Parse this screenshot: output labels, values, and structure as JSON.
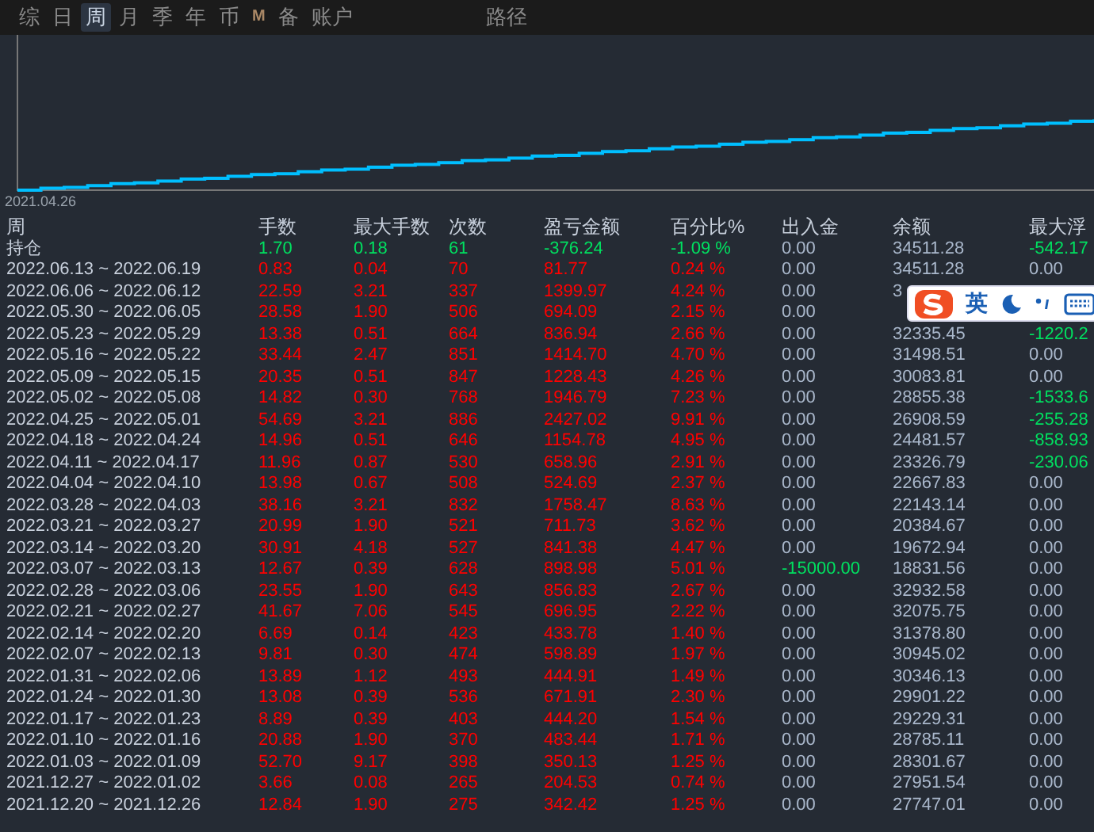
{
  "tabs": [
    {
      "label": "综",
      "selected": false
    },
    {
      "label": "日",
      "selected": false
    },
    {
      "label": "周",
      "selected": true
    },
    {
      "label": "月",
      "selected": false
    },
    {
      "label": "季",
      "selected": false
    },
    {
      "label": "年",
      "selected": false
    },
    {
      "label": "币",
      "selected": false
    },
    {
      "label": "M",
      "selected": false
    },
    {
      "label": "备",
      "selected": false
    },
    {
      "label": "账户",
      "selected": false
    }
  ],
  "path_tab": {
    "label": "路径",
    "selected": false
  },
  "chart": {
    "start_label": "2021.04.26"
  },
  "table": {
    "columns": [
      "周",
      "手数",
      "最大手数",
      "次数",
      "盈亏金额",
      "百分比%",
      "出入金",
      "余额",
      "最大浮"
    ],
    "rows": [
      {
        "kind": "holding",
        "cells": [
          "持仓",
          "1.70",
          "0.18",
          "61",
          "-376.24",
          "-1.09 %",
          "0.00",
          "34511.28",
          "-542.17"
        ],
        "cash_negative": false,
        "float_negative": true
      },
      {
        "kind": "week",
        "cells": [
          "2022.06.13 ~ 2022.06.19",
          "0.83",
          "0.04",
          "70",
          "81.77",
          "0.24 %",
          "0.00",
          "34511.28",
          "0.00"
        ],
        "cash_negative": false,
        "float_negative": false
      },
      {
        "kind": "week",
        "cells": [
          "2022.06.06 ~ 2022.06.12",
          "22.59",
          "3.21",
          "337",
          "1399.97",
          "4.24 %",
          "0.00",
          "3"
        ],
        "cash_negative": false
      },
      {
        "kind": "week",
        "cells": [
          "2022.05.30 ~ 2022.06.05",
          "28.58",
          "1.90",
          "506",
          "694.09",
          "2.15 %",
          "0.00"
        ],
        "cash_negative": false
      },
      {
        "kind": "week",
        "cells": [
          "2022.05.23 ~ 2022.05.29",
          "13.38",
          "0.51",
          "664",
          "836.94",
          "2.66 %",
          "0.00",
          "32335.45",
          "-1220.2"
        ],
        "cash_negative": false,
        "float_negative": true
      },
      {
        "kind": "week",
        "cells": [
          "2022.05.16 ~ 2022.05.22",
          "33.44",
          "2.47",
          "851",
          "1414.70",
          "4.70 %",
          "0.00",
          "31498.51",
          "0.00"
        ],
        "cash_negative": false,
        "float_negative": false
      },
      {
        "kind": "week",
        "cells": [
          "2022.05.09 ~ 2022.05.15",
          "20.35",
          "0.51",
          "847",
          "1228.43",
          "4.26 %",
          "0.00",
          "30083.81",
          "0.00"
        ],
        "cash_negative": false,
        "float_negative": false
      },
      {
        "kind": "week",
        "cells": [
          "2022.05.02 ~ 2022.05.08",
          "14.82",
          "0.30",
          "768",
          "1946.79",
          "7.23 %",
          "0.00",
          "28855.38",
          "-1533.6"
        ],
        "cash_negative": false,
        "float_negative": true
      },
      {
        "kind": "week",
        "cells": [
          "2022.04.25 ~ 2022.05.01",
          "54.69",
          "3.21",
          "886",
          "2427.02",
          "9.91 %",
          "0.00",
          "26908.59",
          "-255.28"
        ],
        "cash_negative": false,
        "float_negative": true
      },
      {
        "kind": "week",
        "cells": [
          "2022.04.18 ~ 2022.04.24",
          "14.96",
          "0.51",
          "646",
          "1154.78",
          "4.95 %",
          "0.00",
          "24481.57",
          "-858.93"
        ],
        "cash_negative": false,
        "float_negative": true
      },
      {
        "kind": "week",
        "cells": [
          "2022.04.11 ~ 2022.04.17",
          "11.96",
          "0.87",
          "530",
          "658.96",
          "2.91 %",
          "0.00",
          "23326.79",
          "-230.06"
        ],
        "cash_negative": false,
        "float_negative": true
      },
      {
        "kind": "week",
        "cells": [
          "2022.04.04 ~ 2022.04.10",
          "13.98",
          "0.67",
          "508",
          "524.69",
          "2.37 %",
          "0.00",
          "22667.83",
          "0.00"
        ],
        "cash_negative": false,
        "float_negative": false
      },
      {
        "kind": "week",
        "cells": [
          "2022.03.28 ~ 2022.04.03",
          "38.16",
          "3.21",
          "832",
          "1758.47",
          "8.63 %",
          "0.00",
          "22143.14",
          "0.00"
        ],
        "cash_negative": false,
        "float_negative": false
      },
      {
        "kind": "week",
        "cells": [
          "2022.03.21 ~ 2022.03.27",
          "20.99",
          "1.90",
          "521",
          "711.73",
          "3.62 %",
          "0.00",
          "20384.67",
          "0.00"
        ],
        "cash_negative": false,
        "float_negative": false
      },
      {
        "kind": "week",
        "cells": [
          "2022.03.14 ~ 2022.03.20",
          "30.91",
          "4.18",
          "527",
          "841.38",
          "4.47 %",
          "0.00",
          "19672.94",
          "0.00"
        ],
        "cash_negative": false,
        "float_negative": false
      },
      {
        "kind": "week",
        "cells": [
          "2022.03.07 ~ 2022.03.13",
          "12.67",
          "0.39",
          "628",
          "898.98",
          "5.01 %",
          "-15000.00",
          "18831.56",
          "0.00"
        ],
        "cash_negative": true,
        "float_negative": false
      },
      {
        "kind": "week",
        "cells": [
          "2022.02.28 ~ 2022.03.06",
          "23.55",
          "1.90",
          "643",
          "856.83",
          "2.67 %",
          "0.00",
          "32932.58",
          "0.00"
        ],
        "cash_negative": false,
        "float_negative": false
      },
      {
        "kind": "week",
        "cells": [
          "2022.02.21 ~ 2022.02.27",
          "41.67",
          "7.06",
          "545",
          "696.95",
          "2.22 %",
          "0.00",
          "32075.75",
          "0.00"
        ],
        "cash_negative": false,
        "float_negative": false
      },
      {
        "kind": "week",
        "cells": [
          "2022.02.14 ~ 2022.02.20",
          "6.69",
          "0.14",
          "423",
          "433.78",
          "1.40 %",
          "0.00",
          "31378.80",
          "0.00"
        ],
        "cash_negative": false,
        "float_negative": false
      },
      {
        "kind": "week",
        "cells": [
          "2022.02.07 ~ 2022.02.13",
          "9.81",
          "0.30",
          "474",
          "598.89",
          "1.97 %",
          "0.00",
          "30945.02",
          "0.00"
        ],
        "cash_negative": false,
        "float_negative": false
      },
      {
        "kind": "week",
        "cells": [
          "2022.01.31 ~ 2022.02.06",
          "13.89",
          "1.12",
          "493",
          "444.91",
          "1.49 %",
          "0.00",
          "30346.13",
          "0.00"
        ],
        "cash_negative": false,
        "float_negative": false
      },
      {
        "kind": "week",
        "cells": [
          "2022.01.24 ~ 2022.01.30",
          "13.08",
          "0.39",
          "536",
          "671.91",
          "2.30 %",
          "0.00",
          "29901.22",
          "0.00"
        ],
        "cash_negative": false,
        "float_negative": false
      },
      {
        "kind": "week",
        "cells": [
          "2022.01.17 ~ 2022.01.23",
          "8.89",
          "0.39",
          "403",
          "444.20",
          "1.54 %",
          "0.00",
          "29229.31",
          "0.00"
        ],
        "cash_negative": false,
        "float_negative": false
      },
      {
        "kind": "week",
        "cells": [
          "2022.01.10 ~ 2022.01.16",
          "20.88",
          "1.90",
          "370",
          "483.44",
          "1.71 %",
          "0.00",
          "28785.11",
          "0.00"
        ],
        "cash_negative": false,
        "float_negative": false
      },
      {
        "kind": "week",
        "cells": [
          "2022.01.03 ~ 2022.01.09",
          "52.70",
          "9.17",
          "398",
          "350.13",
          "1.25 %",
          "0.00",
          "28301.67",
          "0.00"
        ],
        "cash_negative": false,
        "float_negative": false
      },
      {
        "kind": "week",
        "cells": [
          "2021.12.27 ~ 2022.01.02",
          "3.66",
          "0.08",
          "265",
          "204.53",
          "0.74 %",
          "0.00",
          "27951.54",
          "0.00"
        ],
        "cash_negative": false,
        "float_negative": false
      },
      {
        "kind": "week",
        "cells": [
          "2021.12.20 ~ 2021.12.26",
          "12.84",
          "1.90",
          "275",
          "342.42",
          "1.25 %",
          "0.00",
          "27747.01",
          "0.00"
        ],
        "cash_negative": false,
        "float_negative": false
      }
    ]
  },
  "ime_toolbar": {
    "mode": "英"
  }
}
